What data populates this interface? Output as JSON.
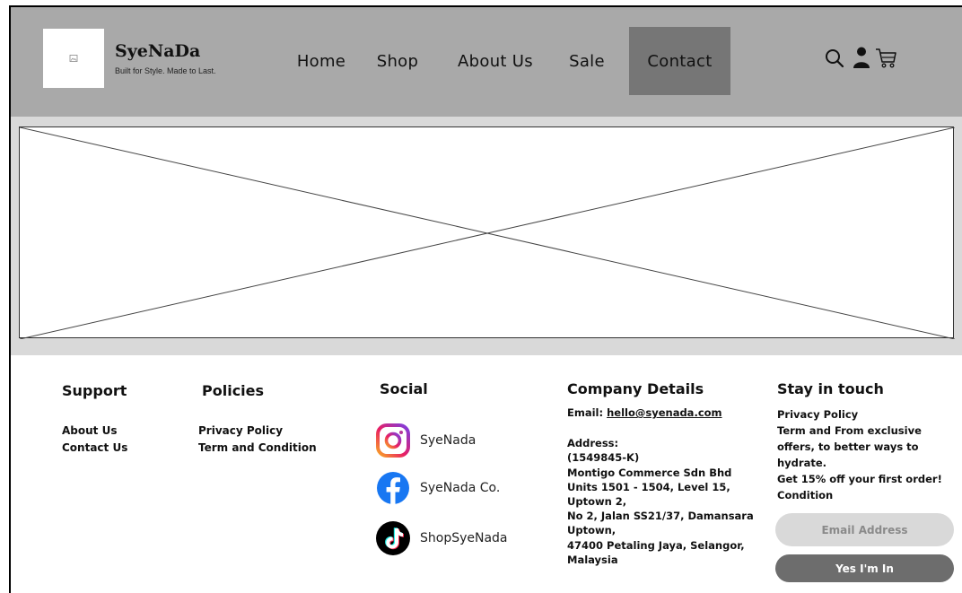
{
  "header": {
    "logo_alt": "logo-image",
    "brand_name": "SyeNaDa",
    "tagline": "Built for Style. Made to Last.",
    "nav": [
      {
        "label": "Home",
        "active": false
      },
      {
        "label": "Shop",
        "active": false
      },
      {
        "label": "About Us",
        "active": false
      },
      {
        "label": "Sale",
        "active": false
      },
      {
        "label": "Contact",
        "active": true
      }
    ],
    "icons": [
      "search-icon",
      "user-icon",
      "cart-icon"
    ]
  },
  "hero": {
    "placeholder": "image-placeholder"
  },
  "footer": {
    "support": {
      "title": "Support",
      "links": [
        "About Us",
        "Contact Us"
      ]
    },
    "policies": {
      "title": "Policies",
      "links": [
        "Privacy Policy",
        "Term and Condition"
      ]
    },
    "social": {
      "title": "Social",
      "items": [
        {
          "icon": "instagram-icon",
          "label": "SyeNada"
        },
        {
          "icon": "facebook-icon",
          "label": "SyeNada Co."
        },
        {
          "icon": "tiktok-icon",
          "label": "ShopSyeNada"
        }
      ]
    },
    "company": {
      "title": "Company Details",
      "email_label": "Email: ",
      "email": "hello@syenada.com",
      "address_lines": [
        "Address:",
        "(1549845-K)",
        "Montigo Commerce Sdn Bhd",
        "Units 1501 - 1504, Level 15,",
        "Uptown 2,",
        "No 2, Jalan SS21/37, Damansara",
        "Uptown,",
        "47400 Petaling Jaya, Selangor,",
        "Malaysia"
      ]
    },
    "stay": {
      "title": "Stay in touch",
      "lines": [
        "Privacy Policy",
        "Term and From exclusive",
        "offers, to better ways to",
        "hydrate.",
        "Get 15% off your first order!",
        "Condition"
      ],
      "email_placeholder": "Email Address",
      "button_label": "Yes I'm In"
    }
  },
  "colors": {
    "header_bg": "#a9a9a9",
    "active_nav_bg": "#767676",
    "hero_band_bg": "#d9d9d9",
    "input_bg": "#d9d9d9",
    "button_bg": "#6d6d6d"
  }
}
